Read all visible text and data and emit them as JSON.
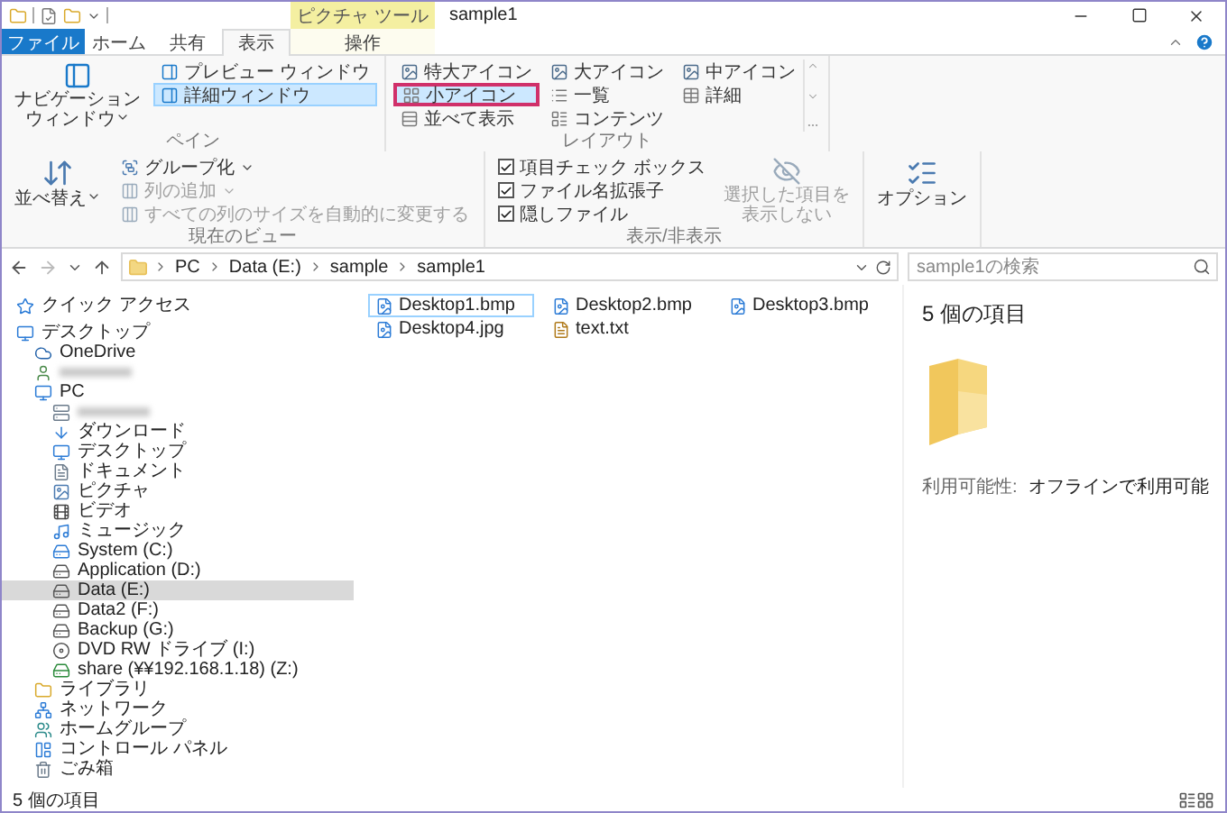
{
  "window": {
    "context_header": "ピクチャ ツール",
    "title": "sample1"
  },
  "tabs": [
    {
      "label": "ファイル",
      "kind": "file",
      "selected": false
    },
    {
      "label": "ホーム",
      "kind": "normal",
      "selected": false
    },
    {
      "label": "共有",
      "kind": "normal",
      "selected": false
    },
    {
      "label": "表示",
      "kind": "normal",
      "selected": true
    },
    {
      "label": "操作",
      "kind": "context",
      "selected": false
    }
  ],
  "ribbon": {
    "groups": [
      {
        "label": "ペイン",
        "items": [
          {
            "kind": "large",
            "label": "ナビゲーションウィンドウ",
            "dropdown": true,
            "disabled": false
          },
          {
            "kind": "stack",
            "entries": [
              {
                "kind": "toggle",
                "label": "プレビュー ウィンドウ",
                "selected": false
              },
              {
                "kind": "toggle",
                "label": "詳細ウィンドウ",
                "selected": true
              }
            ]
          }
        ]
      },
      {
        "label": "レイアウト",
        "items": [
          {
            "kind": "gallery",
            "entries": [
              {
                "label": "特大アイコン",
                "selected": false,
                "highlighted": false
              },
              {
                "label": "大アイコン",
                "selected": false,
                "highlighted": false
              },
              {
                "label": "中アイコン",
                "selected": false,
                "highlighted": false
              },
              {
                "label": "小アイコン",
                "selected": true,
                "highlighted": true
              },
              {
                "label": "一覧",
                "selected": false,
                "highlighted": false
              },
              {
                "label": "詳細",
                "selected": false,
                "highlighted": false
              },
              {
                "label": "並べて表示",
                "selected": false,
                "highlighted": false
              },
              {
                "label": "コンテンツ",
                "selected": false,
                "highlighted": false
              }
            ]
          }
        ]
      },
      {
        "label": "現在のビュー",
        "items": [
          {
            "kind": "large",
            "label": "並べ替え",
            "dropdown": true,
            "disabled": false
          },
          {
            "kind": "stack",
            "entries": [
              {
                "kind": "button",
                "label": "グループ化",
                "dropdown": true,
                "disabled": false
              },
              {
                "kind": "button",
                "label": "列の追加",
                "dropdown": true,
                "disabled": true
              },
              {
                "kind": "button",
                "label": "すべての列のサイズを自動的に変更する",
                "dropdown": false,
                "disabled": true
              }
            ]
          }
        ]
      },
      {
        "label": "表示/非表示",
        "items": [
          {
            "kind": "stack",
            "entries": [
              {
                "kind": "check",
                "label": "項目チェック ボックス",
                "checked": true
              },
              {
                "kind": "check",
                "label": "ファイル名拡張子",
                "checked": true
              },
              {
                "kind": "check",
                "label": "隠しファイル",
                "checked": true
              }
            ]
          },
          {
            "kind": "large",
            "label": "選択した項目を表示しない",
            "dropdown": false,
            "disabled": true
          }
        ]
      },
      {
        "items": [
          {
            "kind": "large",
            "label": "オプション",
            "dropdown": false,
            "disabled": false
          }
        ]
      }
    ]
  },
  "address": {
    "crumbs": [
      "PC",
      "Data (E:)",
      "sample",
      "sample1"
    ]
  },
  "search": {
    "placeholder": "sample1の検索"
  },
  "nav": [
    {
      "label": "クイック アクセス",
      "kind": "star",
      "selected": false
    },
    {
      "label": "デスクトップ",
      "kind": "desktop",
      "selected": false,
      "children": [
        {
          "label": "OneDrive",
          "kind": "cloud",
          "selected": false
        },
        {
          "kind": "user",
          "redacted": true,
          "selected": false
        },
        {
          "label": "PC",
          "kind": "pc",
          "selected": false,
          "children": [
            {
              "kind": "computer",
              "redacted": true,
              "selected": false
            },
            {
              "label": "ダウンロード",
              "kind": "download",
              "selected": false
            },
            {
              "label": "デスクトップ",
              "kind": "desktop",
              "selected": false
            },
            {
              "label": "ドキュメント",
              "kind": "document",
              "selected": false
            },
            {
              "label": "ピクチャ",
              "kind": "pictures",
              "selected": false
            },
            {
              "label": "ビデオ",
              "kind": "video",
              "selected": false
            },
            {
              "label": "ミュージック",
              "kind": "music",
              "selected": false
            },
            {
              "label": "System (C:)",
              "kind": "system-drive",
              "selected": false
            },
            {
              "label": "Application (D:)",
              "kind": "drive",
              "selected": false
            },
            {
              "label": "Data (E:)",
              "kind": "drive",
              "selected": true
            },
            {
              "label": "Data2 (F:)",
              "kind": "drive",
              "selected": false
            },
            {
              "label": "Backup (G:)",
              "kind": "drive",
              "selected": false
            },
            {
              "label": "DVD RW ドライブ (I:)",
              "kind": "dvd",
              "selected": false
            },
            {
              "label": "share (¥¥192.168.1.18) (Z:)",
              "kind": "network-drive",
              "selected": false
            }
          ]
        },
        {
          "label": "ライブラリ",
          "kind": "library",
          "selected": false
        },
        {
          "label": "ネットワーク",
          "kind": "network",
          "selected": false
        },
        {
          "label": "ホームグループ",
          "kind": "homegroup",
          "selected": false
        },
        {
          "label": "コントロール パネル",
          "kind": "control-panel",
          "selected": false
        },
        {
          "label": "ごみ箱",
          "kind": "recycle-bin",
          "selected": false
        }
      ]
    }
  ],
  "files": [
    {
      "name": "Desktop1.bmp",
      "kind": "image",
      "focused": true
    },
    {
      "name": "Desktop2.bmp",
      "kind": "image",
      "focused": false
    },
    {
      "name": "Desktop3.bmp",
      "kind": "image",
      "focused": false
    },
    {
      "name": "Desktop4.jpg",
      "kind": "image",
      "focused": false
    },
    {
      "name": "text.txt",
      "kind": "text",
      "focused": false
    }
  ],
  "details": {
    "title": "5 個の項目",
    "properties": [
      {
        "name": "利用可能性:",
        "value": "オフラインで利用可能"
      }
    ]
  },
  "status_bar": {
    "text": "5 個の項目"
  }
}
